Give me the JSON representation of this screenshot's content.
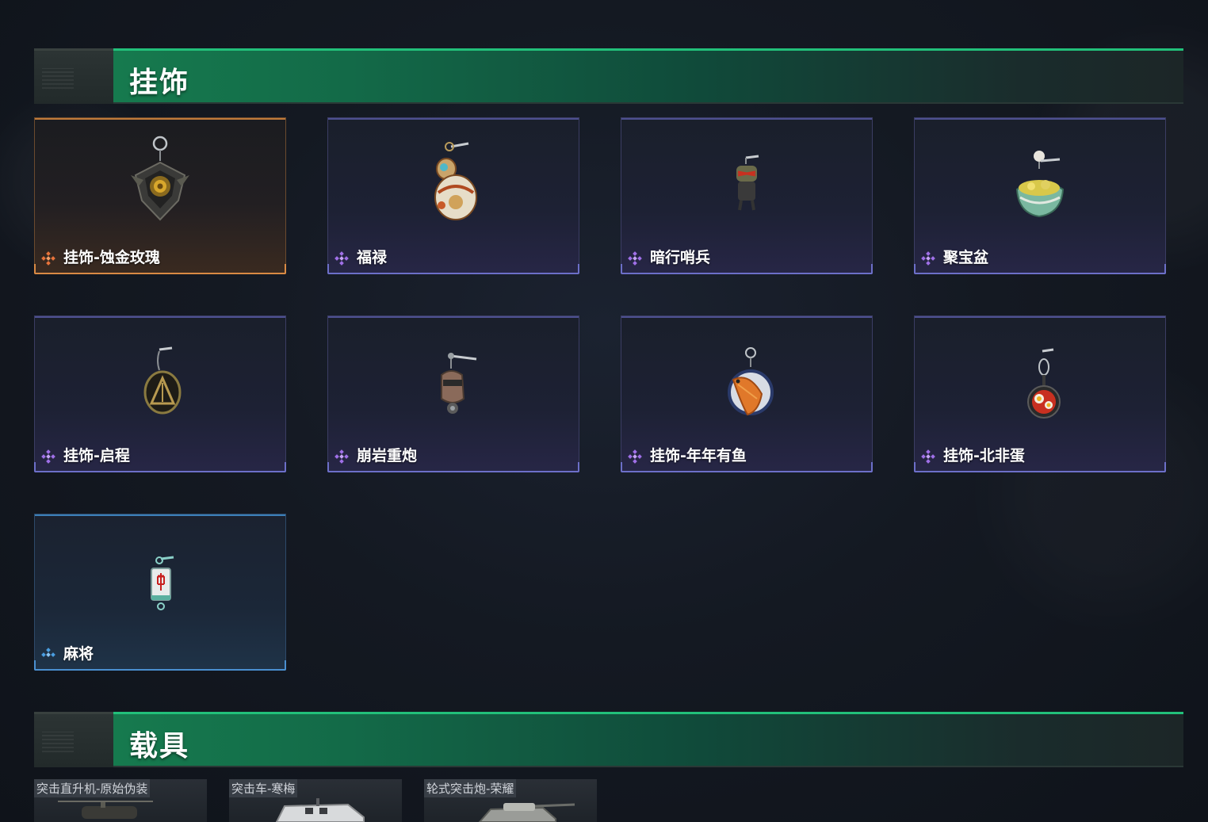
{
  "sections": {
    "charms": {
      "title": "挂饰"
    },
    "vehicles": {
      "title": "载具"
    }
  },
  "charms": [
    {
      "name": "挂饰-蚀金玫瑰",
      "rarity": "legendary",
      "art": "rose-charm-icon"
    },
    {
      "name": "福禄",
      "rarity": "epic",
      "art": "gourd-charm-icon"
    },
    {
      "name": "暗行哨兵",
      "rarity": "epic",
      "art": "sentinel-charm-icon"
    },
    {
      "name": "聚宝盆",
      "rarity": "epic",
      "art": "treasure-bowl-charm-icon"
    },
    {
      "name": "挂饰-启程",
      "rarity": "epic",
      "art": "medallion-charm-icon"
    },
    {
      "name": "崩岩重炮",
      "rarity": "epic",
      "art": "robot-charm-icon"
    },
    {
      "name": "挂饰-年年有鱼",
      "rarity": "epic",
      "art": "fish-charm-icon"
    },
    {
      "name": "挂饰-北非蛋",
      "rarity": "epic",
      "art": "pan-charm-icon"
    },
    {
      "name": "麻将",
      "rarity": "rare",
      "art": "mahjong-charm-icon"
    }
  ],
  "vehicles": [
    {
      "name": "突击直升机-原始伪装"
    },
    {
      "name": "突击车-寒梅"
    },
    {
      "name": "轮式突击炮-荣耀"
    }
  ],
  "colors": {
    "legendary": "#e8733a",
    "epic": "#a070e8",
    "rare": "#4a9ee0",
    "header_green": "#167a4e"
  }
}
